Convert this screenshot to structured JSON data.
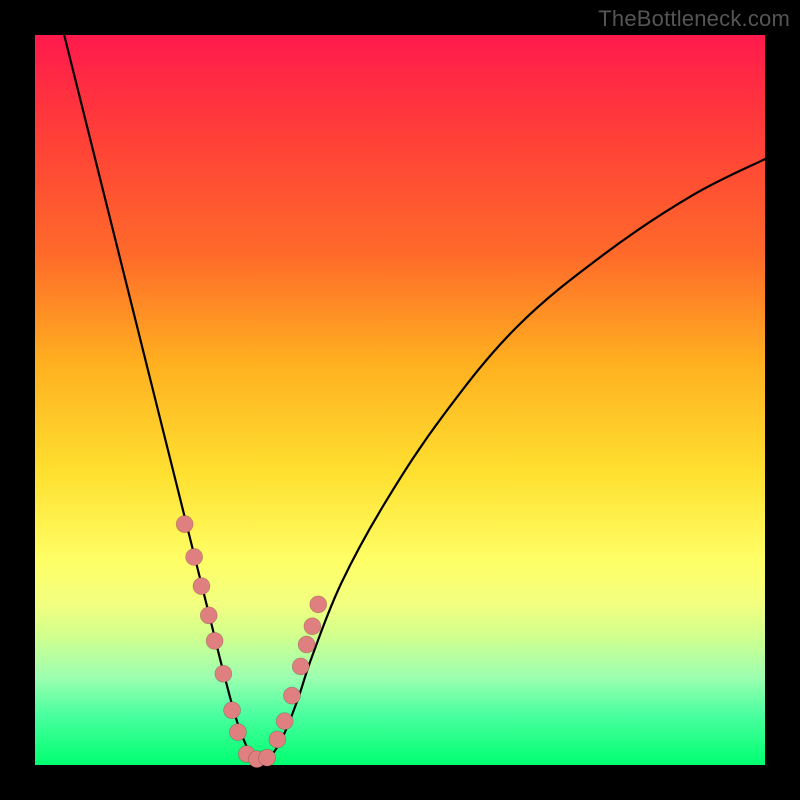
{
  "watermark": "TheBottleneck.com",
  "colors": {
    "marker_fill": "#e07f7f",
    "line_stroke": "#000000",
    "frame": "#000000"
  },
  "chart_data": {
    "type": "line",
    "title": "",
    "xlabel": "",
    "ylabel": "",
    "xlim": [
      0,
      100
    ],
    "ylim": [
      0,
      100
    ],
    "grid": false,
    "legend": false,
    "notes": "V-shaped bottleneck curve. Y is percent bottleneck (0 at minimum, ~100 at extremes). Minimum of curve around x≈30. Markers are clustered near the trough (low-bottleneck region). No axis tick labels are rendered in the image; values below are estimated from geometry on a 0–100 scale.",
    "series": [
      {
        "name": "bottleneck-curve",
        "x": [
          4,
          6,
          8,
          10,
          12,
          14,
          16,
          18,
          20,
          22,
          24,
          26,
          28,
          30,
          32,
          34,
          36,
          38,
          42,
          48,
          56,
          66,
          78,
          90,
          100
        ],
        "y": [
          100,
          92,
          84,
          76,
          68,
          60,
          52,
          44,
          36,
          28,
          20,
          12,
          5,
          1,
          1,
          4,
          9,
          15,
          25,
          36,
          48,
          60,
          70,
          78,
          83
        ]
      }
    ],
    "markers": {
      "name": "highlighted-points",
      "x": [
        20.5,
        21.8,
        22.8,
        23.8,
        24.6,
        25.8,
        27.0,
        27.8,
        29.0,
        30.4,
        31.8,
        33.2,
        34.2,
        35.2,
        36.4,
        37.2,
        38.0,
        38.8
      ],
      "y": [
        33.0,
        28.5,
        24.5,
        20.5,
        17.0,
        12.5,
        7.5,
        4.5,
        1.5,
        0.8,
        1.0,
        3.5,
        6.0,
        9.5,
        13.5,
        16.5,
        19.0,
        22.0
      ]
    }
  }
}
